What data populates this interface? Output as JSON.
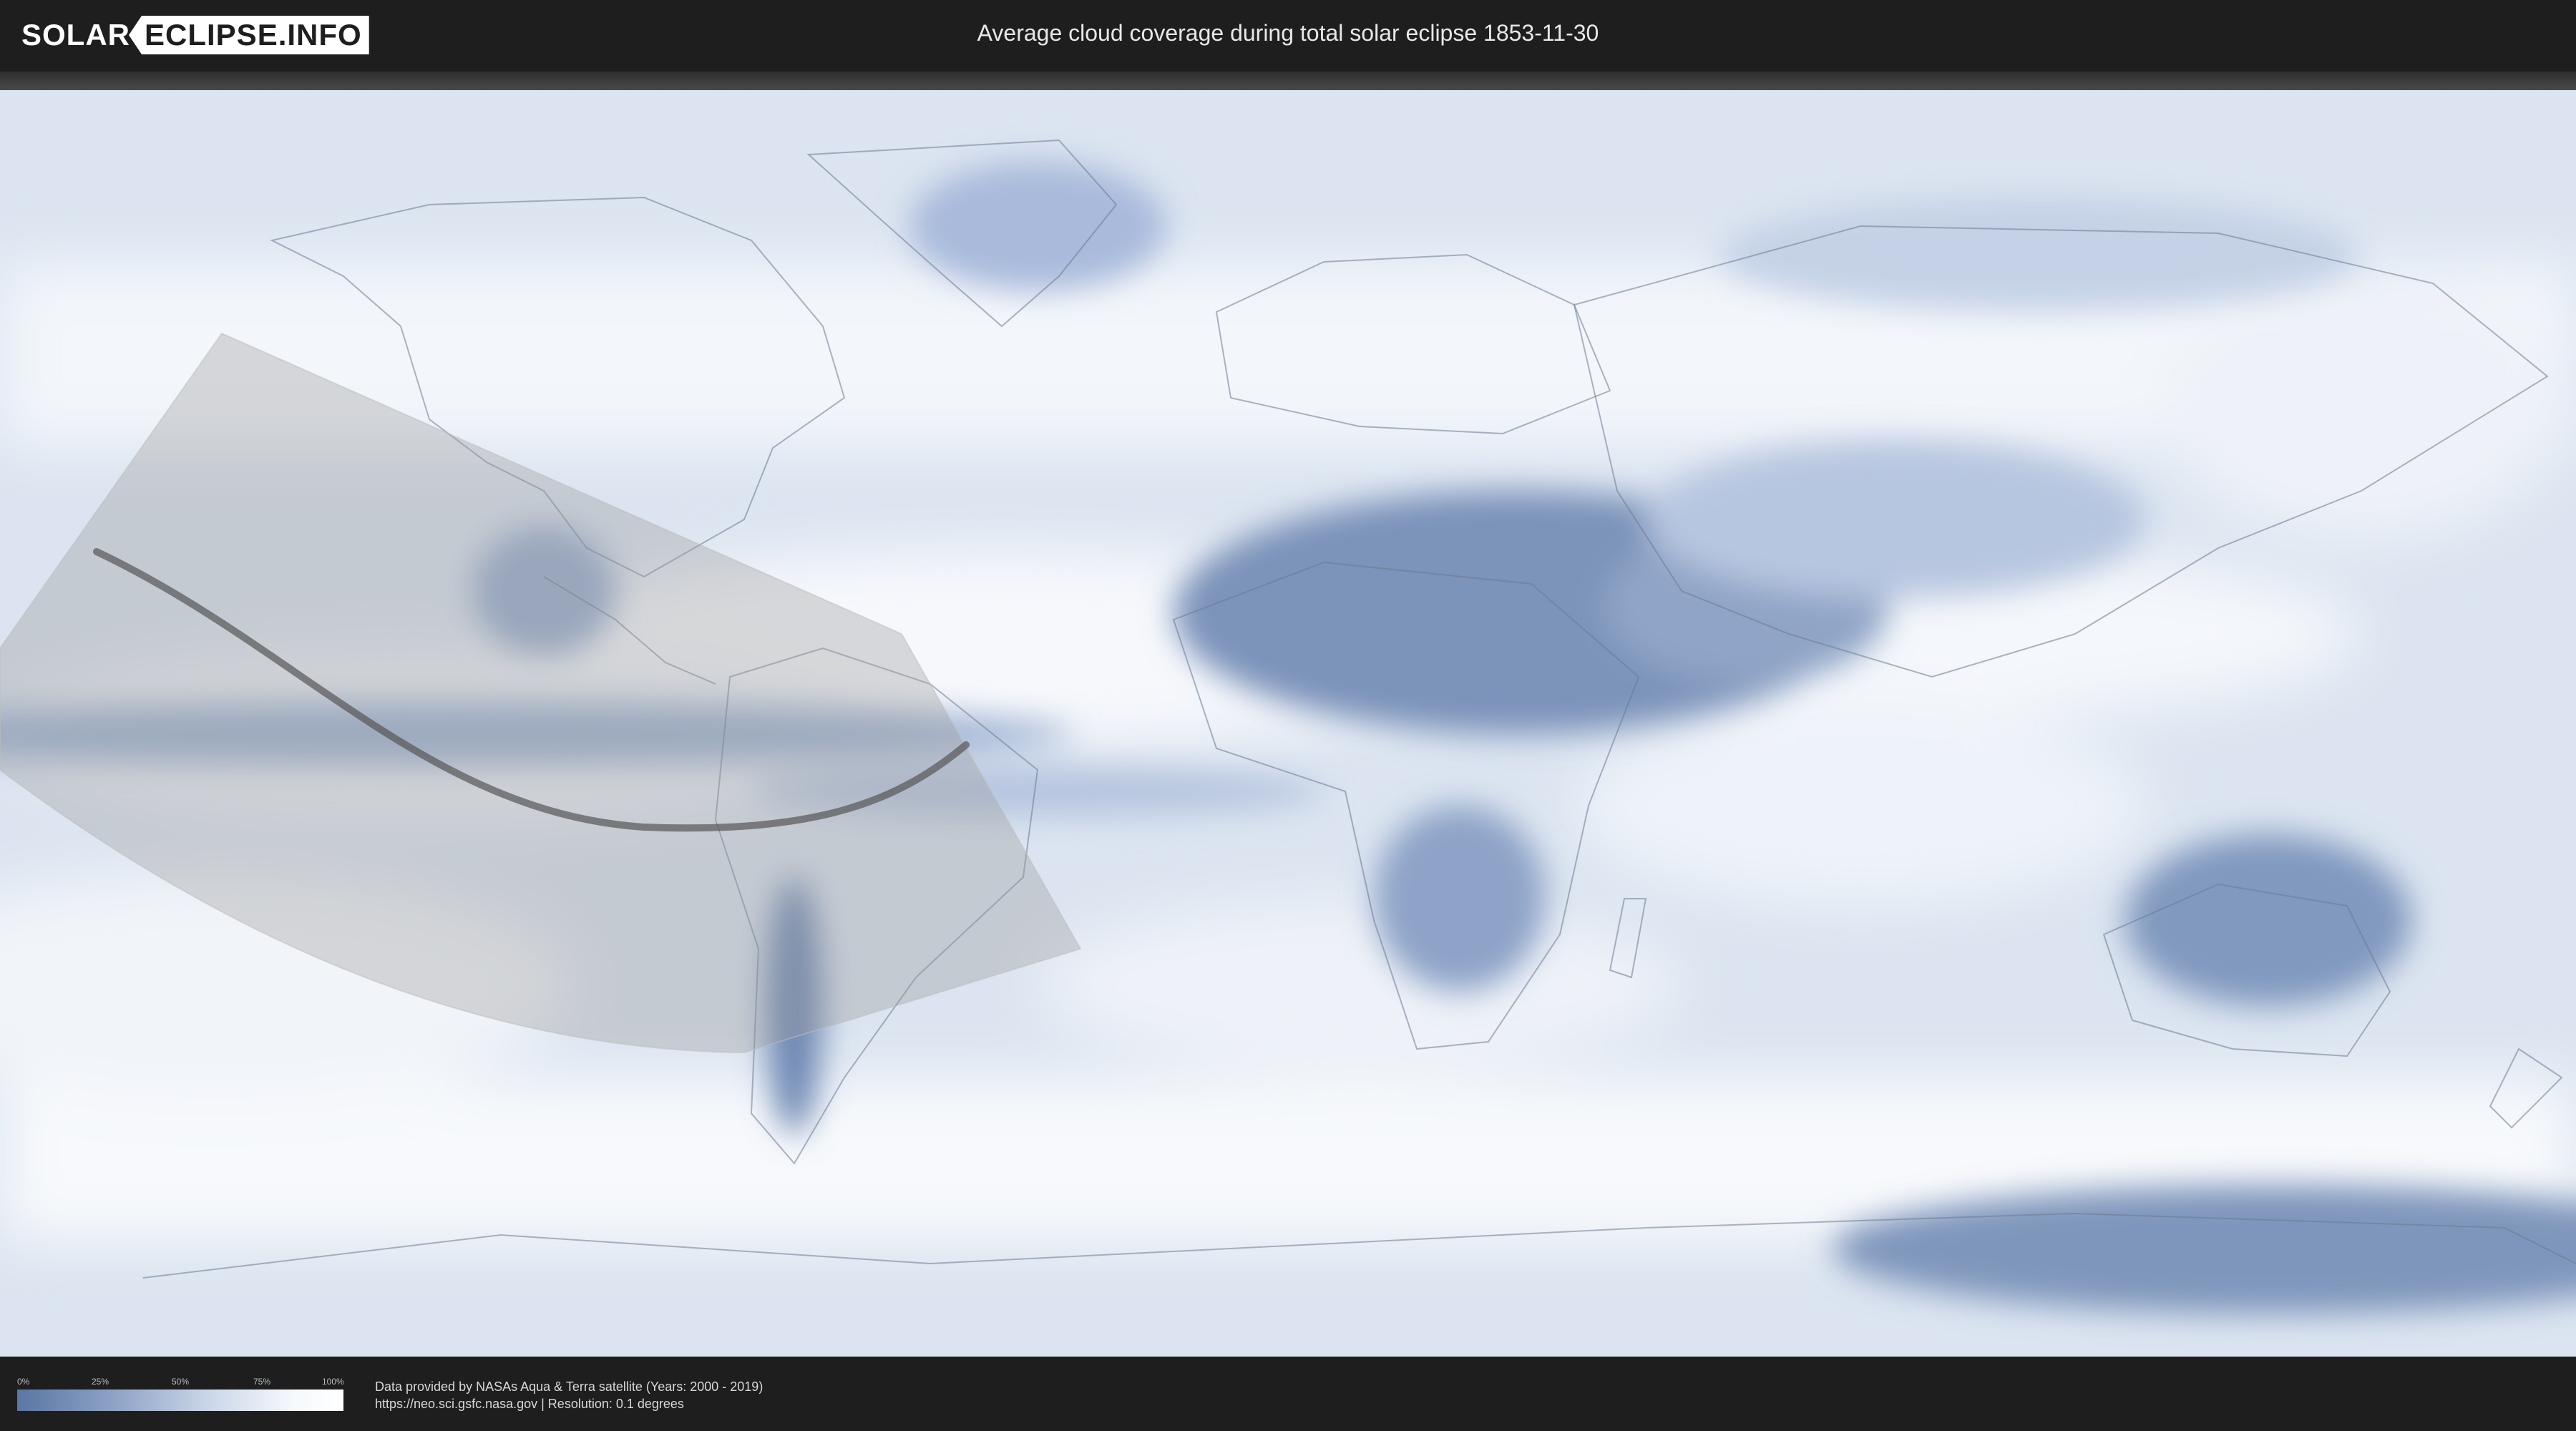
{
  "header": {
    "logo_left": "SOLAR",
    "logo_right": "ECLIPSE.INFO",
    "title": "Average cloud coverage during total solar eclipse 1853-11-30"
  },
  "legend": {
    "ticks": [
      "0%",
      "25%",
      "50%",
      "75%",
      "100%"
    ],
    "gradient_colors": [
      "#5a76a4",
      "#8ea3c6",
      "#cdd8ea",
      "#f6f9fd",
      "#ffffff"
    ]
  },
  "footer": {
    "credit_line1": "Data provided by NASAs Aqua & Terra satellite (Years: 2000 - 2019)",
    "credit_line2": "https://neo.sci.gsfc.nasa.gov | Resolution: 0.1 degrees"
  },
  "map": {
    "projection": "equirectangular",
    "colors": {
      "clear_sky": "#5a76a4",
      "overcast": "#ffffff",
      "eclipse_band": "#9a9a9a",
      "central_line": "#555555"
    }
  }
}
